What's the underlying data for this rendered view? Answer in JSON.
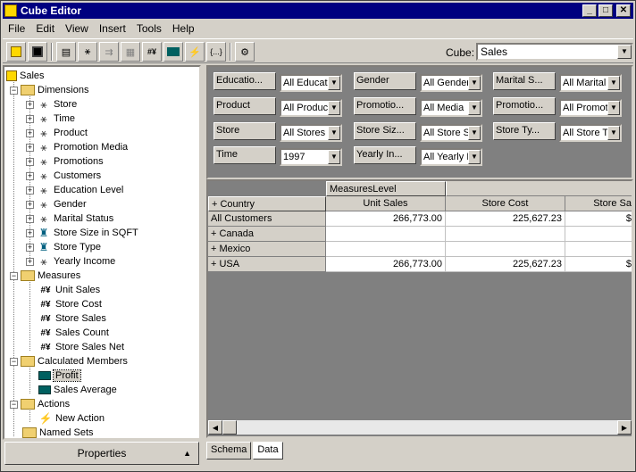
{
  "window": {
    "title": "Cube Editor"
  },
  "menu": [
    "File",
    "Edit",
    "View",
    "Insert",
    "Tools",
    "Help"
  ],
  "toolbar": {
    "cube_label": "Cube:",
    "cube_value": "Sales",
    "expr_button": "{...}"
  },
  "tree": {
    "root": "Sales",
    "dimensions_label": "Dimensions",
    "dimensions": [
      "Store",
      "Time",
      "Product",
      "Promotion Media",
      "Promotions",
      "Customers",
      "Education Level",
      "Gender",
      "Marital Status",
      "Store Size in SQFT",
      "Store Type",
      "Yearly Income"
    ],
    "measures_label": "Measures",
    "measures": [
      "Unit Sales",
      "Store Cost",
      "Store Sales",
      "Sales Count",
      "Store Sales Net"
    ],
    "calculated_label": "Calculated Members",
    "calculated": [
      "Profit",
      "Sales Average"
    ],
    "actions_label": "Actions",
    "actions": [
      "New Action"
    ],
    "named_sets_label": "Named Sets"
  },
  "properties_button": "Properties",
  "filters": [
    {
      "label": "Educatio...",
      "value": "All Educat"
    },
    {
      "label": "Gender",
      "value": "All Gender"
    },
    {
      "label": "Marital S...",
      "value": "All Marital"
    },
    {
      "label": "Product",
      "value": "All Produc"
    },
    {
      "label": "Promotio...",
      "value": "All Media"
    },
    {
      "label": "Promotio...",
      "value": "All Promot"
    },
    {
      "label": "Store",
      "value": "All Stores"
    },
    {
      "label": "Store Siz...",
      "value": "All Store S"
    },
    {
      "label": "Store Ty...",
      "value": "All Store T"
    },
    {
      "label": "Time",
      "value": "1997"
    },
    {
      "label": "Yearly In...",
      "value": "All Yearly I"
    }
  ],
  "grid": {
    "measures_level": "MeasuresLevel",
    "row_header": "+ Country",
    "columns": [
      "Unit Sales",
      "Store Cost",
      "Store Sa"
    ],
    "rows": [
      {
        "label": "All Customers",
        "values": [
          "266,773.00",
          "225,627.23",
          "$"
        ]
      },
      {
        "label": "+  Canada",
        "values": [
          "",
          "",
          ""
        ]
      },
      {
        "label": "+  Mexico",
        "values": [
          "",
          "",
          ""
        ]
      },
      {
        "label": "+  USA",
        "values": [
          "266,773.00",
          "225,627.23",
          "$"
        ]
      }
    ]
  },
  "tabs": [
    "Schema",
    "Data"
  ]
}
